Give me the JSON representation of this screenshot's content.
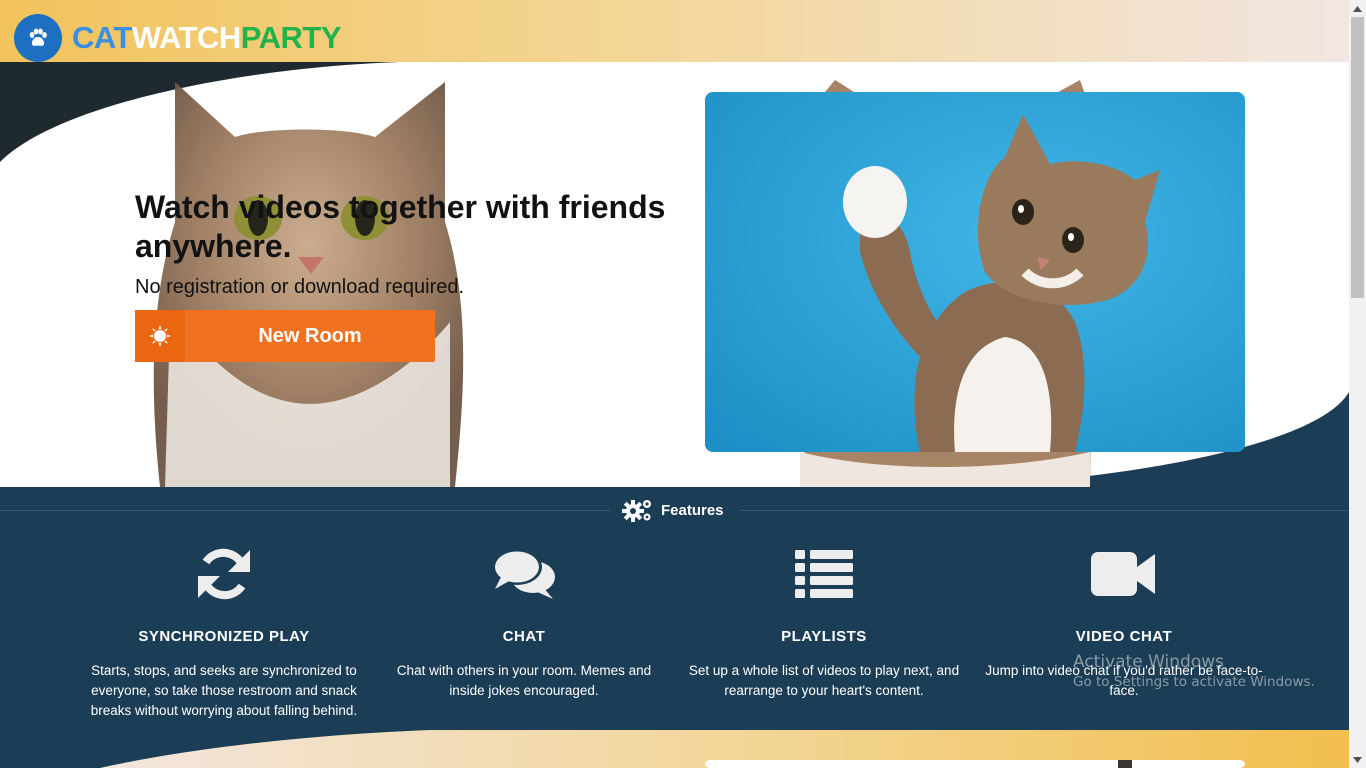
{
  "header": {
    "brand_part1": "CAT",
    "brand_part2": "WATCH",
    "brand_part3": "PARTY",
    "logo_icon": "paw-icon"
  },
  "hero": {
    "title": "Watch videos together with friends anywhere.",
    "subtitle": "No registration or download required.",
    "new_room_label": "New Room",
    "new_room_icon": "sun-icon"
  },
  "features": {
    "heading": "Features",
    "heading_icon": "gears-icon",
    "items": [
      {
        "title": "SYNCHRONIZED PLAY",
        "description": "Starts, stops, and seeks are synchronized to everyone, so take those restroom and snack breaks without worrying about falling behind.",
        "icon": "sync-icon"
      },
      {
        "title": "CHAT",
        "description": "Chat with others in your room. Memes and inside jokes encouraged.",
        "icon": "chat-icon"
      },
      {
        "title": "PLAYLISTS",
        "description": "Set up a whole list of videos to play next, and rearrange to your heart's content.",
        "icon": "list-icon"
      },
      {
        "title": "VIDEO CHAT",
        "description": "Jump into video chat if you'd rather be face-to-face.",
        "icon": "video-camera-icon"
      }
    ]
  },
  "watermark": {
    "line1": "Activate Windows",
    "line2": "Go to Settings to activate Windows."
  },
  "colors": {
    "header_gradient_start": "#f2c35c",
    "navy": "#1c3d56",
    "accent_orange": "#f07120",
    "brand_blue": "#3a8fe0",
    "brand_green": "#22b24c",
    "photo_sky": "#29a6dc"
  }
}
